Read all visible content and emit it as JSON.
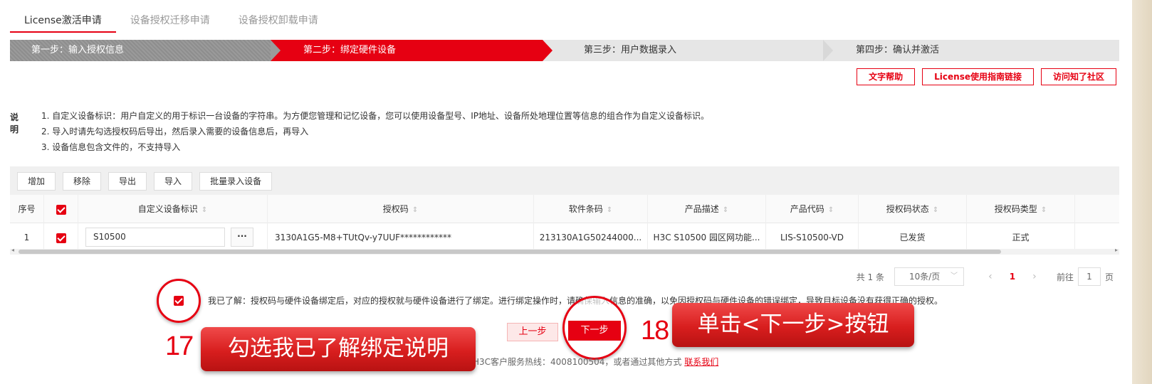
{
  "top_tabs": [
    "License激活申请",
    "设备授权迁移申请",
    "设备授权卸载申请"
  ],
  "steps": [
    "第一步：输入授权信息",
    "第二步：绑定硬件设备",
    "第三步：用户数据录入",
    "第四步：确认并激活"
  ],
  "help_buttons": [
    "文字帮助",
    "License使用指南链接",
    "访问知了社区"
  ],
  "description": {
    "label": "说明",
    "lines": [
      "1. 自定义设备标识：用户自定义的用于标识一台设备的字符串。为方便您管理和记忆设备，您可以使用设备型号、IP地址、设备所处地理位置等信息的组合作为自定义设备标识。",
      "2. 导入时请先勾选授权码后导出，然后录入需要的设备信息后，再导入",
      "3. 设备信息包含文件的，不支持导入"
    ]
  },
  "toolbar": [
    "增加",
    "移除",
    "导出",
    "导入",
    "批量录入设备"
  ],
  "table": {
    "headers": [
      "序号",
      "自定义设备标识",
      "授权码",
      "软件条码",
      "产品描述",
      "产品代码",
      "授权码状态",
      "授权码类型"
    ],
    "row": {
      "index": "1",
      "device_id": "S10500",
      "more": "···",
      "license_code": "3130A1G5-M8+TUtQv-y7UUF************",
      "barcode": "213130A1G50244000...",
      "description": "H3C S10500 园区网功能...",
      "product_code": "LIS-S10500-VD",
      "status": "已发货",
      "type": "正式"
    }
  },
  "pagination": {
    "total": "共 1 条",
    "page_size": "10条/页",
    "prev": "‹",
    "current_page": "1",
    "next": "›",
    "goto_label": "前往",
    "goto_value": "1",
    "page_unit": "页"
  },
  "agreement": "我已了解：授权码与硬件设备绑定后，对应的授权就与硬件设备进行了绑定。进行绑定操作时，请确保输入信息的准确，以免因授权码与硬件设备的错误绑定，导致目标设备没有获得正确的授权。",
  "buttons": {
    "prev": "上一步",
    "next": "下一步"
  },
  "footer": {
    "text": "H3C客户服务热线：4008100504，或者通过其他方式",
    "link": "联系我们"
  },
  "callouts": {
    "num17": "17",
    "text17": "勾选我已了解绑定说明",
    "num18": "18",
    "text18": "单击<下一步>按钮"
  },
  "colors": {
    "accent": "#e60012",
    "step_done": "#999999",
    "step_todo": "#e6e6e6"
  },
  "icons": [
    "checkbox-checked-icon",
    "sort-icon",
    "chevron-down-icon",
    "chevron-left-icon",
    "chevron-right-icon"
  ]
}
